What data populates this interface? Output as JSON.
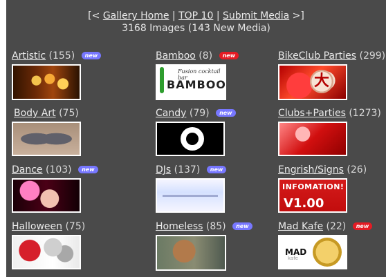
{
  "header": {
    "prefix": "[<",
    "gallery_home": "Gallery Home",
    "sep1": "|",
    "top10": "TOP 10",
    "sep2": "|",
    "submit_media": "Submit Media",
    "suffix": ">]",
    "summary": "3168 Images (143 New Media)"
  },
  "categories": [
    {
      "name": "Artistic",
      "count": "(155)",
      "badge": "new"
    },
    {
      "name": "Bamboo",
      "count": "(8)",
      "badge": "new"
    },
    {
      "name": "BikeClub Parties",
      "count": "(299)",
      "badge": ""
    },
    {
      "name": "Body Art",
      "count": "(75)",
      "badge": ""
    },
    {
      "name": "Candy",
      "count": "(79)",
      "badge": "new"
    },
    {
      "name": "Clubs+Parties",
      "count": "(1273)",
      "badge": ""
    },
    {
      "name": "Dance",
      "count": "(103)",
      "badge": "new"
    },
    {
      "name": "DJs",
      "count": "(137)",
      "badge": "new"
    },
    {
      "name": "Engrish/Signs",
      "count": "(26)",
      "badge": ""
    },
    {
      "name": "Halloween",
      "count": "(75)",
      "badge": ""
    },
    {
      "name": "Homeless",
      "count": "(85)",
      "badge": "new"
    },
    {
      "name": "Mad Kafe",
      "count": "(22)",
      "badge": "new"
    }
  ],
  "thumb_text": {
    "bamboo_tagline": "Fusion cocktail bar",
    "bamboo_brand": "BAMBOO",
    "bikeclub_glyph": "大",
    "engrish_line1": "INFOMATION!",
    "engrish_line2": "V1.00",
    "madkafe_mad": "MAD",
    "madkafe_kafe": "kafe"
  },
  "colors": {
    "panel_bg": "#4a4a4a",
    "text": "#e6e6e6",
    "badge_blue": "#7777ff",
    "badge_red": "#e51b24"
  }
}
